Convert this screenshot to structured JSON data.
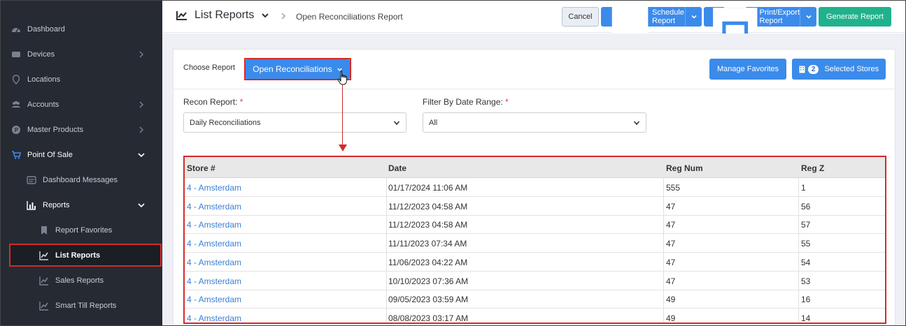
{
  "sidebar": {
    "items": [
      {
        "label": "Dashboard",
        "icon": "gauge-icon",
        "chevron": false
      },
      {
        "label": "Devices",
        "icon": "devices-icon",
        "chevron": true
      },
      {
        "label": "Locations",
        "icon": "map-pin-icon",
        "chevron": false
      },
      {
        "label": "Accounts",
        "icon": "users-icon",
        "chevron": true
      },
      {
        "label": "Master Products",
        "icon": "product-p-icon",
        "chevron": true
      },
      {
        "label": "Point Of Sale",
        "icon": "cart-icon",
        "chevron": true,
        "open": true
      },
      {
        "label": "Dashboard Messages",
        "icon": "message-icon",
        "chevron": false
      },
      {
        "label": "Reports",
        "icon": "bar-chart-icon",
        "chevron": true,
        "open": true
      },
      {
        "label": "Report Favorites",
        "icon": "bookmark-icon",
        "chevron": false
      },
      {
        "label": "List Reports",
        "icon": "line-chart-icon",
        "chevron": false,
        "active": true
      },
      {
        "label": "Sales Reports",
        "icon": "line-chart-icon",
        "chevron": false
      },
      {
        "label": "Smart Till Reports",
        "icon": "line-chart-icon",
        "chevron": false
      }
    ]
  },
  "header": {
    "title": "List Reports",
    "breadcrumb": "Open Reconciliations Report",
    "cancel_label": "Cancel",
    "schedule_label": "Schedule Report",
    "print_label": "Print/Export Report",
    "generate_label": "Generate Report"
  },
  "report": {
    "choose_label": "Choose Report",
    "selected": "Open Reconciliations",
    "manage_favorites_label": "Manage Favorites",
    "selected_stores_count": "2",
    "selected_stores_label": "Selected Stores"
  },
  "filters": {
    "recon_label": "Recon Report:",
    "recon_value": "Daily Reconciliations",
    "date_label": "Filter By Date Range:",
    "date_value": "All",
    "required_mark": "*"
  },
  "table": {
    "columns": [
      "Store #",
      "Date",
      "Reg Num",
      "Reg Z"
    ],
    "rows": [
      [
        "4 - Amsterdam",
        "01/17/2024 11:06 AM",
        "555",
        "1"
      ],
      [
        "4 - Amsterdam",
        "11/12/2023 04:58 AM",
        "47",
        "56"
      ],
      [
        "4 - Amsterdam",
        "11/12/2023 04:58 AM",
        "47",
        "57"
      ],
      [
        "4 - Amsterdam",
        "11/11/2023 07:34 AM",
        "47",
        "55"
      ],
      [
        "4 - Amsterdam",
        "11/06/2023 04:22 AM",
        "47",
        "54"
      ],
      [
        "4 - Amsterdam",
        "10/10/2023 07:36 AM",
        "47",
        "53"
      ],
      [
        "4 - Amsterdam",
        "09/05/2023 03:59 AM",
        "49",
        "16"
      ],
      [
        "4 - Amsterdam",
        "08/08/2023 03:17 AM",
        "49",
        "14"
      ]
    ]
  },
  "colors": {
    "sidebar_bg": "#262a33",
    "primary": "#3b8beb",
    "success": "#20b28c",
    "annotation": "#d32b2b",
    "link": "#3a7fd5"
  }
}
